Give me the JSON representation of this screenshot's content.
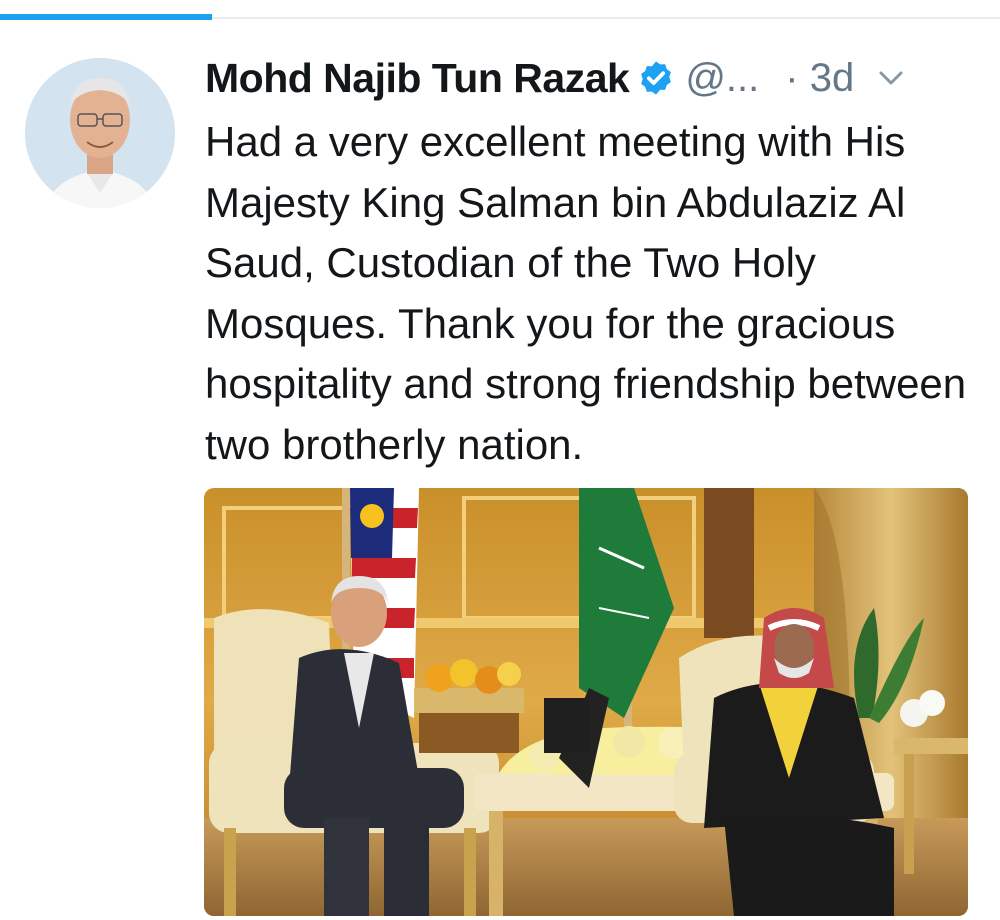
{
  "tweet": {
    "display_name": "Mohd Najib Tun Razak",
    "handle": "@...",
    "time": "· 3d",
    "text": "Had a very excellent meeting with His Majesty King Salman bin Abdulaziz Al Saud, Custodian of the Two Holy Mosques. Thank you for the gracious hospitality and strong friendship between two brotherly nation."
  },
  "icons": {
    "verified": "verified-badge-icon",
    "more": "chevron-down-icon"
  },
  "colors": {
    "accent": "#1da1f2",
    "text": "#14171a",
    "secondary": "#657786"
  }
}
